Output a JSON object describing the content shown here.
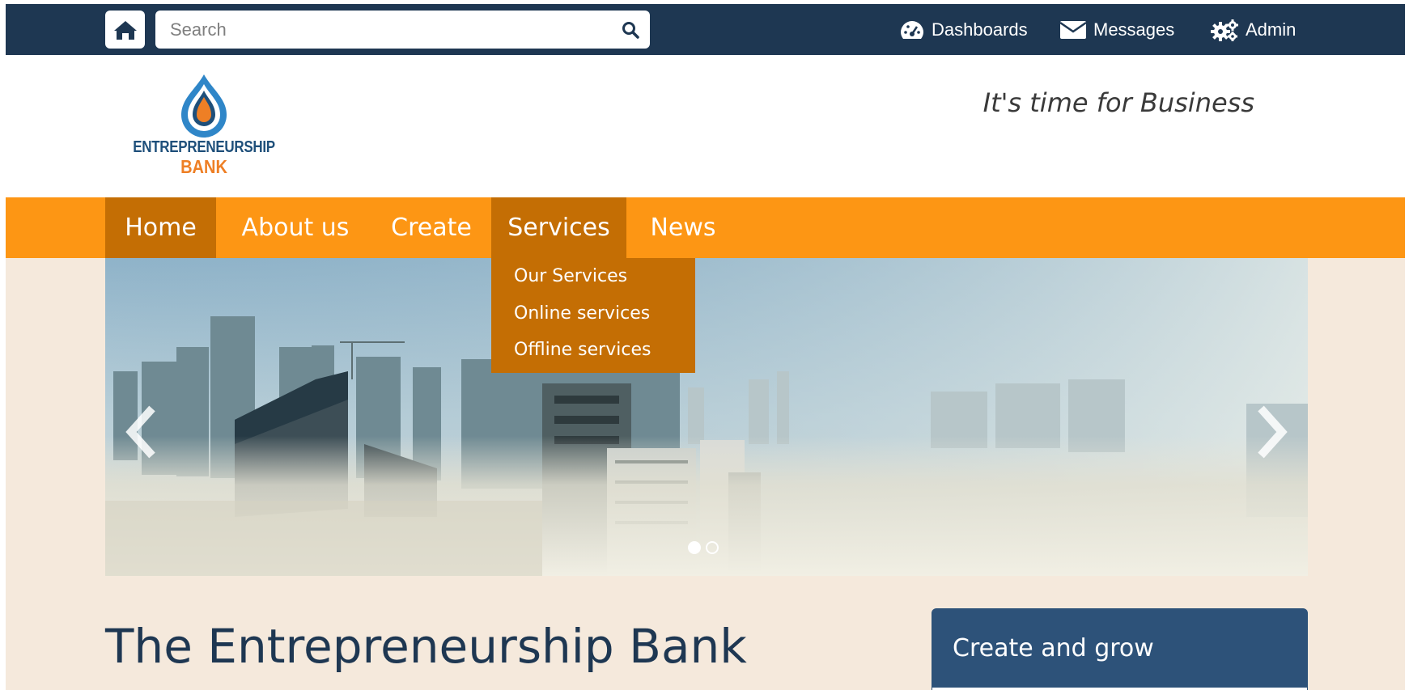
{
  "topbar": {
    "search_placeholder": "Search",
    "links": {
      "dashboards": "Dashboards",
      "messages": "Messages",
      "admin": "Admin"
    }
  },
  "header": {
    "logo_line1": "ENTREPRENEURSHIP",
    "logo_line2": "BANK",
    "tagline": "It's time for Business"
  },
  "nav": {
    "items": [
      "Home",
      "About us",
      "Create",
      "Services",
      "News"
    ],
    "active": "Home",
    "open_menu": "Services",
    "dropdown": [
      "Our Services",
      "Online services",
      "Offline services"
    ]
  },
  "carousel": {
    "slides": 2,
    "current": 1
  },
  "main": {
    "title": "The Entrepreneurship Bank"
  },
  "panel": {
    "title": "Create and grow"
  },
  "colors": {
    "topbar": "#1e3752",
    "nav": "#fd9614",
    "nav_active": "#c46e04",
    "page_bg": "#f5e9dc",
    "panel": "#2d5279",
    "logo_blue": "#1e4f7a",
    "logo_orange": "#ee7f25"
  },
  "icons": {
    "home": "home-icon",
    "search": "search-icon",
    "dashboards": "dashboard-gauge-icon",
    "messages": "envelope-icon",
    "admin": "gears-icon",
    "prev": "chevron-left-icon",
    "next": "chevron-right-icon"
  }
}
